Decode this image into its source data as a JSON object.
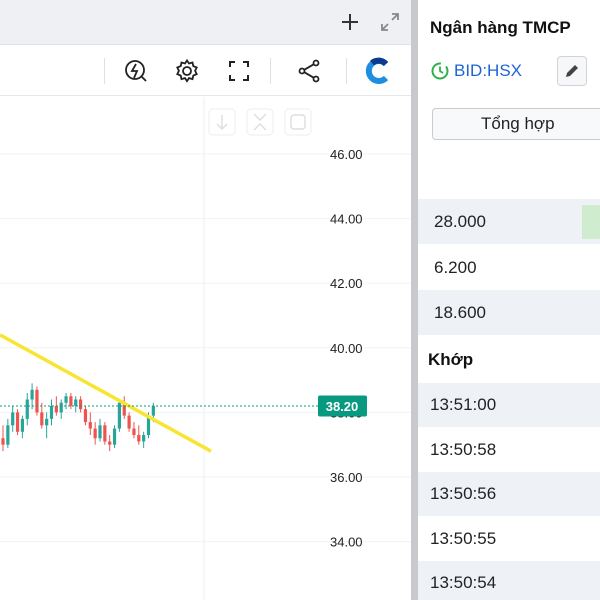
{
  "tabbar": {
    "add_icon": "plus-icon",
    "expand_icon": "expand-icon"
  },
  "toolbar": {
    "icons": [
      "indicator-lightning-icon",
      "gear-icon",
      "fullscreen-icon",
      "share-icon",
      "brand-logo-icon"
    ]
  },
  "chart_data": {
    "type": "candlestick",
    "yaxis_ticks": [
      "46.00",
      "44.00",
      "42.00",
      "40.00",
      "38.00",
      "36.00",
      "34.00"
    ],
    "ylim": [
      33.3,
      47.6
    ],
    "last_price": "38.20",
    "price_tag_color": "#089981",
    "up_color": "#26a69a",
    "down_color": "#ef5350",
    "trendline_color": "#f7e531",
    "trendline": {
      "from": [
        0,
        40.4
      ],
      "to": [
        1,
        36.8
      ]
    },
    "candles_ohlc": [
      [
        37.2,
        37.6,
        36.8,
        37.0
      ],
      [
        37.0,
        37.8,
        36.9,
        37.6
      ],
      [
        37.6,
        38.2,
        37.4,
        38.0
      ],
      [
        38.0,
        38.1,
        37.3,
        37.4
      ],
      [
        37.4,
        37.9,
        37.2,
        37.8
      ],
      [
        37.8,
        38.6,
        37.6,
        38.4
      ],
      [
        38.4,
        38.9,
        38.1,
        38.7
      ],
      [
        38.7,
        38.8,
        37.9,
        38.0
      ],
      [
        38.0,
        38.3,
        37.5,
        37.6
      ],
      [
        37.6,
        38.0,
        37.2,
        37.8
      ],
      [
        37.8,
        38.4,
        37.6,
        38.2
      ],
      [
        38.2,
        38.5,
        37.9,
        38.0
      ],
      [
        38.0,
        38.4,
        37.8,
        38.3
      ],
      [
        38.3,
        38.6,
        38.1,
        38.5
      ],
      [
        38.5,
        38.6,
        38.1,
        38.2
      ],
      [
        38.2,
        38.5,
        38.0,
        38.4
      ],
      [
        38.4,
        38.5,
        38.0,
        38.1
      ],
      [
        38.1,
        38.2,
        37.6,
        37.7
      ],
      [
        37.7,
        38.0,
        37.3,
        37.5
      ],
      [
        37.5,
        37.7,
        37.0,
        37.2
      ],
      [
        37.2,
        37.8,
        37.1,
        37.6
      ],
      [
        37.6,
        37.7,
        37.0,
        37.1
      ],
      [
        37.1,
        37.3,
        36.8,
        37.0
      ],
      [
        37.0,
        37.6,
        36.9,
        37.5
      ],
      [
        37.5,
        38.4,
        37.4,
        38.3
      ],
      [
        38.3,
        38.5,
        37.8,
        37.9
      ],
      [
        37.9,
        38.0,
        37.4,
        37.5
      ],
      [
        37.5,
        37.7,
        37.2,
        37.3
      ],
      [
        37.3,
        37.6,
        37.0,
        37.1
      ],
      [
        37.1,
        37.4,
        36.9,
        37.3
      ],
      [
        37.3,
        38.0,
        37.2,
        37.9
      ],
      [
        37.9,
        38.3,
        37.7,
        38.2
      ]
    ]
  },
  "info": {
    "title": "Ngân hàng TMCP",
    "ticker": "BID:HSX",
    "summary_button": "Tổng hợp",
    "values": [
      "28.000",
      "6.200",
      "18.600"
    ],
    "match_heading": "Khớp",
    "trades": [
      "13:51:00",
      "13:50:58",
      "13:50:56",
      "13:50:55",
      "13:50:54"
    ]
  }
}
